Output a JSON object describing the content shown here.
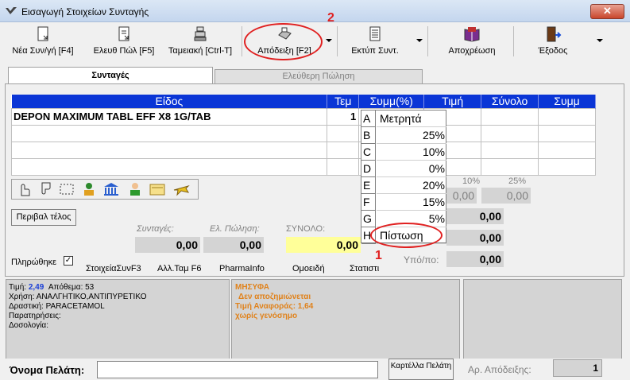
{
  "window": {
    "title": "Εισαγωγή Στοιχείων Συνταγής",
    "close_label": "✕"
  },
  "toolbar": {
    "items": [
      {
        "label": "Νέα Συν/γή [F4]",
        "icon": "new-prescription-icon"
      },
      {
        "label": "Ελευθ Πώλ [F5]",
        "icon": "free-sale-icon"
      },
      {
        "label": "Ταμειακή [Ctrl-T]",
        "icon": "cash-register-icon"
      },
      {
        "label": "Απόδειξη [F2]",
        "icon": "printer-icon"
      },
      {
        "label": "Εκτύπ Συντ.",
        "icon": "print-list-icon"
      },
      {
        "label": "Αποχρέωση",
        "icon": "book-icon"
      },
      {
        "label": "Έξοδος",
        "icon": "exit-door-icon"
      }
    ]
  },
  "tabs": [
    {
      "label": "Συνταγές",
      "active": true
    },
    {
      "label": "Ελεύθερη Πώληση",
      "active": false
    }
  ],
  "grid": {
    "headers": [
      "Είδος",
      "Τεμ",
      "Συμμ(%)",
      "Τιμή",
      "Σύνολο",
      "Συμμ"
    ],
    "rows": [
      {
        "item": "DEPON MAXIMUM TABL EFF X8 1G/TAB",
        "qty": "1"
      }
    ]
  },
  "popup": {
    "options": [
      {
        "key": "A",
        "value": "Μετρητά"
      },
      {
        "key": "B",
        "value": "25%"
      },
      {
        "key": "C",
        "value": "10%"
      },
      {
        "key": "D",
        "value": "0%"
      },
      {
        "key": "E",
        "value": "20%"
      },
      {
        "key": "F",
        "value": "15%"
      },
      {
        "key": "G",
        "value": "5%"
      },
      {
        "key": "H",
        "value": "Πίστωση"
      }
    ]
  },
  "summary": {
    "perivallon_button": "Περιβαλ τέλος",
    "syntages_label": "Συνταγές:",
    "el_polisi_label": "Ελ. Πώληση:",
    "synolo_label": "ΣΥΝΟΛΟ:",
    "syntages_value": "0,00",
    "el_polisi_value": "0,00",
    "synolo_value": "0,00",
    "pct10_label": "10%",
    "pct25_label": "25%",
    "pct10_value": "0,00",
    "pct25_value": "0,00",
    "right_value_1": "0,00",
    "right_value_2": "0,00",
    "ypoloipo_label": "Υπό/πο:",
    "ypoloipo_value": "0,00",
    "paid_label": "Πληρώθηκε",
    "paid_check": "✓"
  },
  "links": [
    "ΣτοιχείαΣυνF3",
    "Αλλ.Ταμ F6",
    "PharmaInfo",
    "Ομοειδή",
    "Στατιστι"
  ],
  "info_left": {
    "price_label": "Τιμή:",
    "price_value": "2,49",
    "stock": "Απόθεμα: 53",
    "usage": "Χρήση: ΑΝΑΛΓΗΤΙΚΟ,ΑΝΤΙΠΥΡΕΤΙΚΟ",
    "substance": "Δραστική: PARACETAMOL",
    "notes": "Παρατηρήσεις:",
    "dosage": "Δοσολογία:"
  },
  "info_mid": {
    "line1": "ΜΗΣΥΦΑ",
    "line2": "Δεν αποζημιώνεται",
    "line3": "Τιμή Αναφοράς: 1,64",
    "line4": "χωρίς γενόσημο"
  },
  "bottom": {
    "customer_label": "Όνομα Πελάτη:",
    "customer_value": "",
    "card_button": "Καρτέλλα Πελάτη",
    "receipt_label": "Αρ. Απόδειξης:",
    "receipt_value": "1"
  },
  "annotations": {
    "one": "1",
    "two": "2"
  },
  "colors": {
    "grid_header": "#0a35d6",
    "total_highlight": "#ffff99",
    "annotation": "#e02020",
    "info_orange": "#e0821b"
  }
}
